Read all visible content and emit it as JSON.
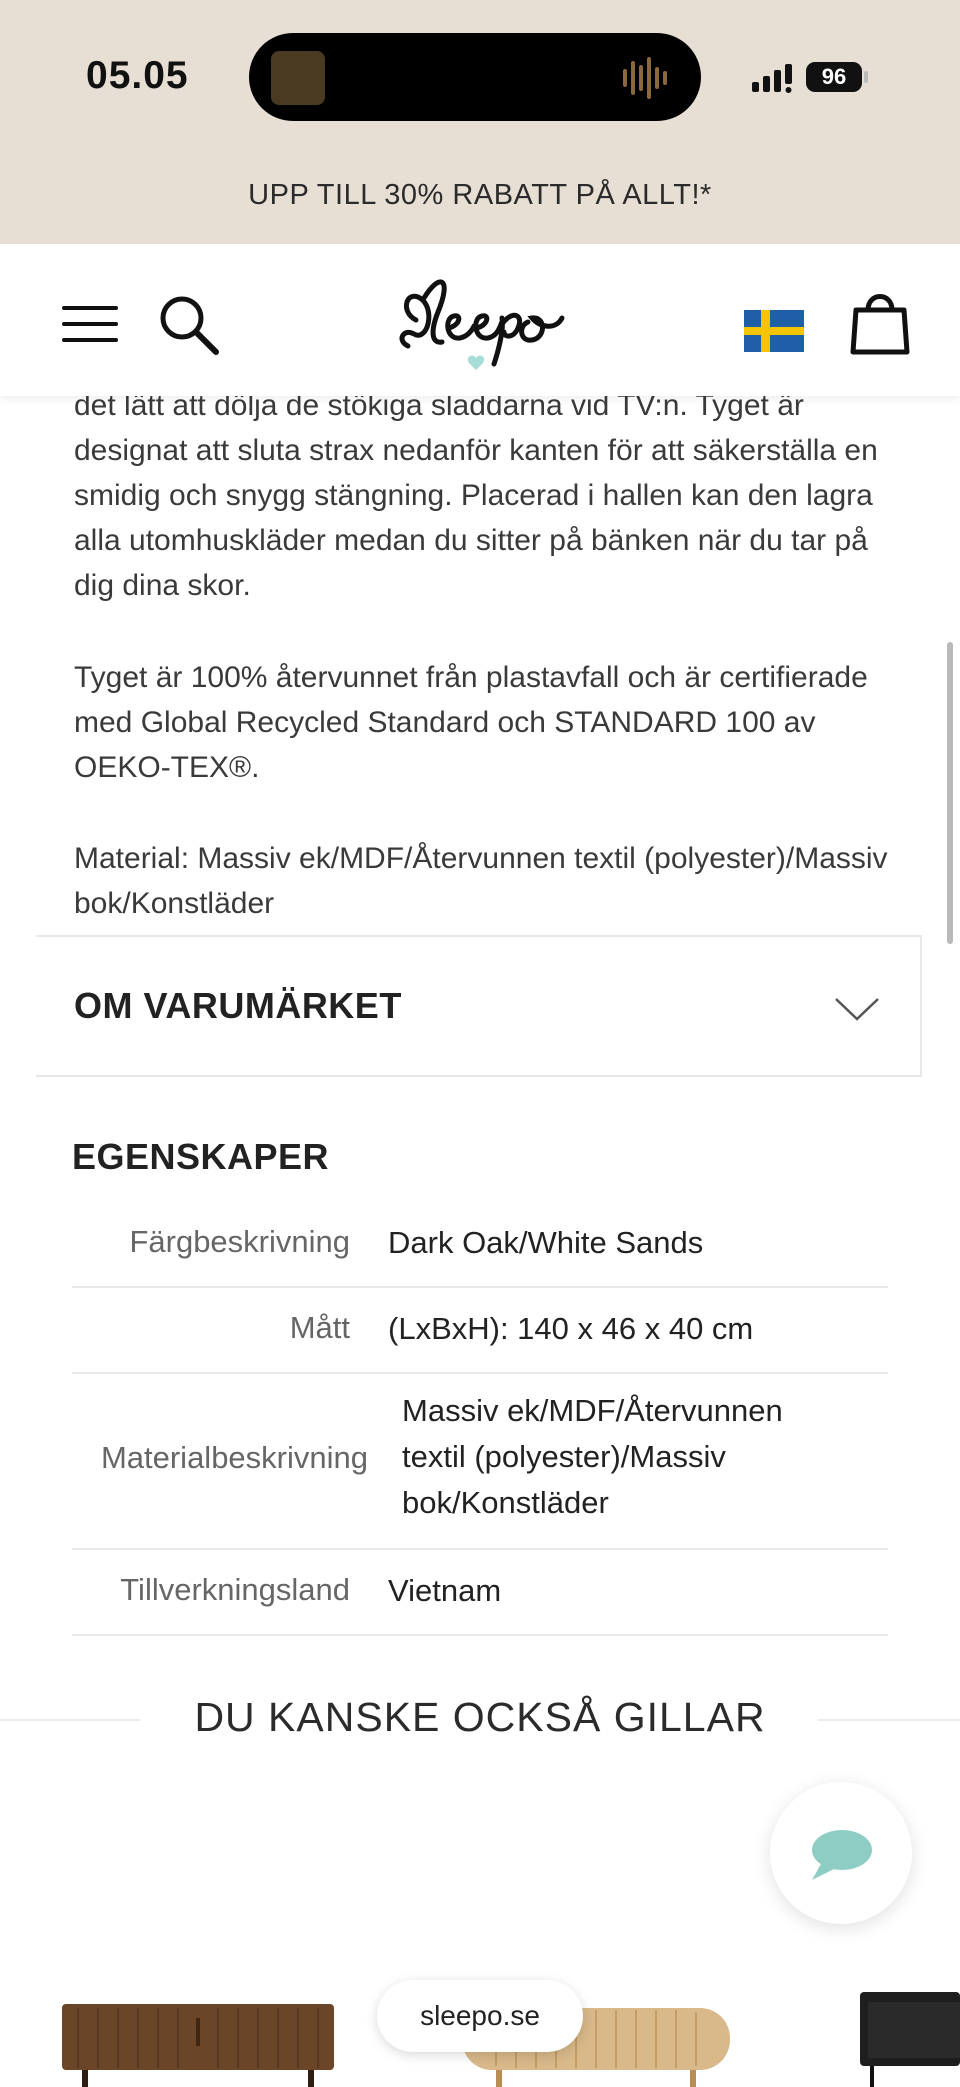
{
  "status_bar": {
    "time": "05.05",
    "battery": "96"
  },
  "promo_banner": {
    "text": "UPP TILL 30% RABATT PÅ ALLT!*"
  },
  "header": {
    "logo": "Sleepo",
    "menu_icon": "hamburger-icon",
    "search_icon": "search-icon",
    "flag_icon": "sweden-flag-icon",
    "cart_icon": "shopping-bag-icon"
  },
  "description": {
    "paragraph1": "det lätt att dölja de stökiga sladdarna vid TV:n. Tyget är designat att sluta strax nedanför kanten för att säkerställa en smidig och snygg stängning. Placerad i hallen kan den lagra alla utomhuskläder medan du sitter på bänken när du tar på dig dina skor.",
    "paragraph2": "Tyget är 100% återvunnet från plastavfall och är certifierade med Global Recycled Standard och STANDARD 100 av OEKO-TEX®.",
    "paragraph3": "Material: Massiv ek/MDF/Återvunnen textil (polyester)/Massiv bok/Konstläder"
  },
  "brand_accordion": {
    "title": "OM VARUMÄRKET"
  },
  "properties": {
    "title": "EGENSKAPER",
    "rows": [
      {
        "label": "Färgbeskrivning",
        "value": "Dark Oak/White Sands"
      },
      {
        "label": "Mått",
        "value": "(LxBxH): 140 x 46 x 40 cm"
      },
      {
        "label": "Materialbeskrivning",
        "value": "Massiv ek/MDF/Återvunnen textil (polyester)/Massiv bok/Konstläder"
      },
      {
        "label": "Tillverkningsland",
        "value": "Vietnam"
      }
    ]
  },
  "recommendations": {
    "title": "DU KANSKE OCKSÅ GILLAR"
  },
  "browser": {
    "url": "sleepo.se"
  },
  "colors": {
    "beige": "#e7dfd4",
    "chat_icon": "#8ecdc4",
    "flag_blue": "#1f5fa8",
    "flag_yellow": "#f5c400"
  }
}
